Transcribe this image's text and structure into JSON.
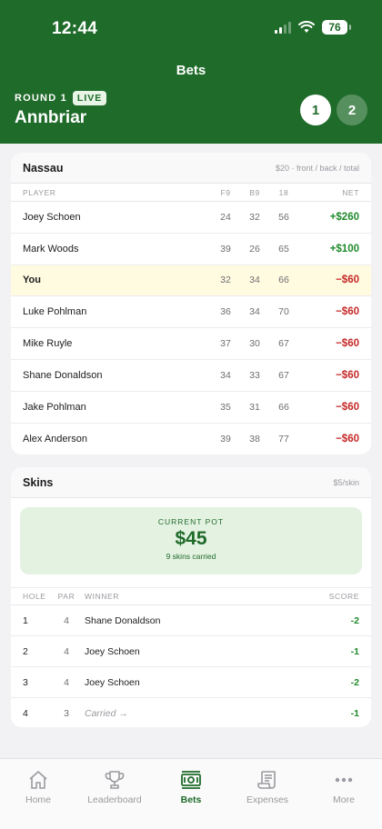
{
  "status": {
    "time": "12:44",
    "battery": "76"
  },
  "header": {
    "title": "Bets",
    "round_label": "ROUND 1",
    "live_badge": "LIVE",
    "course": "Annbriar",
    "rounds": [
      "1",
      "2"
    ]
  },
  "nassau": {
    "title": "Nassau",
    "meta": "$20 · front / back / total",
    "columns": {
      "player": "PLAYER",
      "f9": "F9",
      "b9": "B9",
      "total": "18",
      "net": "NET"
    },
    "rows": [
      {
        "player": "Joey Schoen",
        "f9": "24",
        "b9": "32",
        "total": "56",
        "net": "+$260",
        "tone": "pos"
      },
      {
        "player": "Mark Woods",
        "f9": "39",
        "b9": "26",
        "total": "65",
        "net": "+$100",
        "tone": "pos"
      },
      {
        "player": "You",
        "f9": "32",
        "b9": "34",
        "total": "66",
        "net": "−$60",
        "tone": "neg",
        "highlight": true
      },
      {
        "player": "Luke Pohlman",
        "f9": "36",
        "b9": "34",
        "total": "70",
        "net": "−$60",
        "tone": "neg"
      },
      {
        "player": "Mike Ruyle",
        "f9": "37",
        "b9": "30",
        "total": "67",
        "net": "−$60",
        "tone": "neg"
      },
      {
        "player": "Shane Donaldson",
        "f9": "34",
        "b9": "33",
        "total": "67",
        "net": "−$60",
        "tone": "neg"
      },
      {
        "player": "Jake Pohlman",
        "f9": "35",
        "b9": "31",
        "total": "66",
        "net": "−$60",
        "tone": "neg"
      },
      {
        "player": "Alex Anderson",
        "f9": "39",
        "b9": "38",
        "total": "77",
        "net": "−$60",
        "tone": "neg"
      }
    ]
  },
  "skins": {
    "title": "Skins",
    "meta": "$5/skin",
    "pot": {
      "label": "CURRENT POT",
      "amount": "$45",
      "sub": "9 skins carried"
    },
    "columns": {
      "hole": "HOLE",
      "par": "PAR",
      "winner": "WINNER",
      "score": "SCORE"
    },
    "rows": [
      {
        "hole": "1",
        "par": "4",
        "winner": "Shane Donaldson",
        "score": "-2"
      },
      {
        "hole": "2",
        "par": "4",
        "winner": "Joey Schoen",
        "score": "-1"
      },
      {
        "hole": "3",
        "par": "4",
        "winner": "Joey Schoen",
        "score": "-2"
      },
      {
        "hole": "4",
        "par": "3",
        "winner": "Carried →",
        "score": "-1",
        "carried": true
      }
    ]
  },
  "tabs": [
    {
      "label": "Home",
      "icon": "home-icon"
    },
    {
      "label": "Leaderboard",
      "icon": "trophy-icon"
    },
    {
      "label": "Bets",
      "icon": "cash-icon",
      "active": true
    },
    {
      "label": "Expenses",
      "icon": "receipt-icon"
    },
    {
      "label": "More",
      "icon": "more-icon"
    }
  ],
  "colors": {
    "brand": "#1f6b2a",
    "positive": "#1f8a2a",
    "negative": "#c62828",
    "highlight": "#fffbe0"
  }
}
